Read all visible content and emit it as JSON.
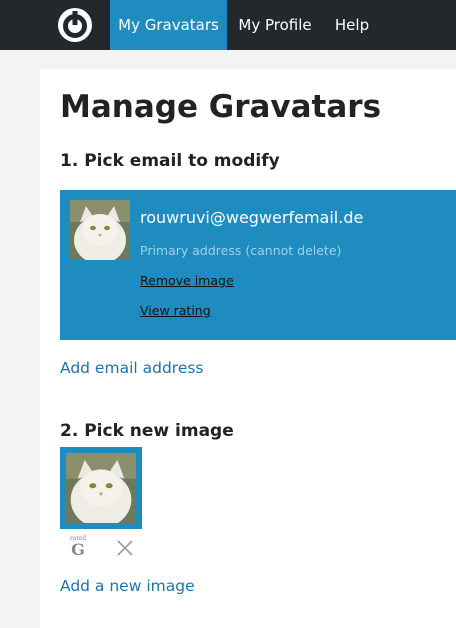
{
  "nav": {
    "tabs": [
      {
        "label": "My Gravatars",
        "active": true
      },
      {
        "label": "My Profile",
        "active": false
      },
      {
        "label": "Help",
        "active": false
      }
    ]
  },
  "page": {
    "title": "Manage Gravatars",
    "step1_title": "1. Pick email to modify",
    "step2_title": "2. Pick new image"
  },
  "email_card": {
    "email": "rouwruvi@wegwerfemail.de",
    "note": "Primary address (cannot delete)",
    "remove_label": "Remove image",
    "rating_label": "View rating"
  },
  "links": {
    "add_email": "Add email address",
    "add_image": "Add a new image"
  },
  "image": {
    "rating_small": "rated",
    "rating": "G"
  },
  "colors": {
    "topbar": "#23282d",
    "accent": "#1e8cbe",
    "link": "#1e73a8"
  }
}
